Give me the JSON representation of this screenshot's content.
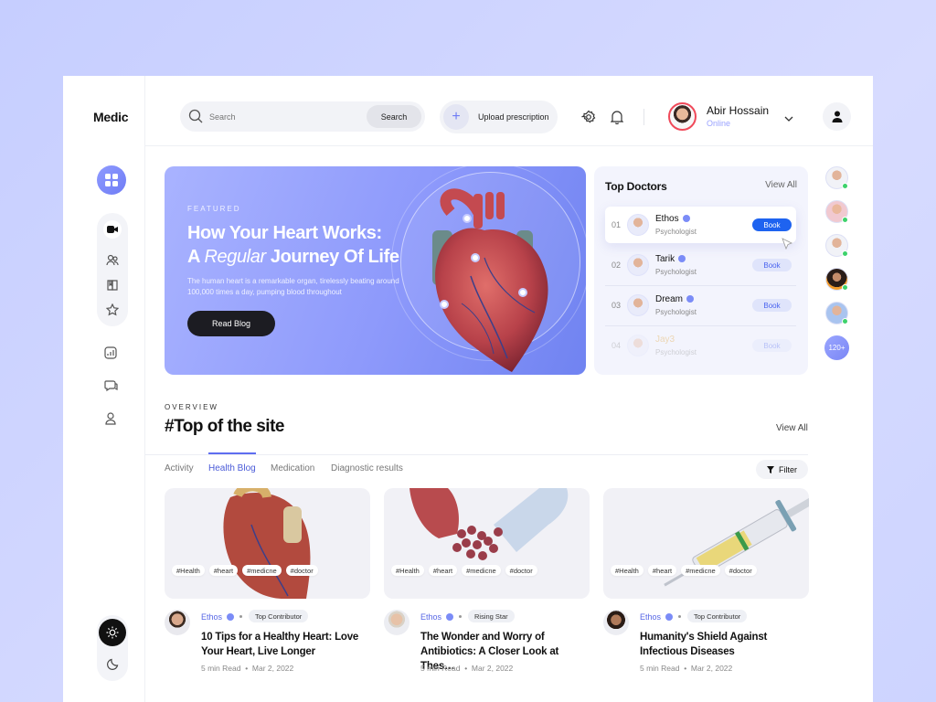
{
  "app": {
    "logo": "Medic"
  },
  "header": {
    "search_placeholder": "Search",
    "search_button": "Search",
    "upload_label": "Upload prescription",
    "user_name": "Abir Hossain",
    "user_status": "Online"
  },
  "hero": {
    "eyebrow": "FEATURED",
    "title_line1": "How Your Heart Works:",
    "title_line2_pre": "A ",
    "title_line2_em": "Regular",
    "title_line2_post": " Journey Of Life",
    "description": "The human heart is a remarkable organ, tirelessly beating around 100,000 times a day, pumping blood throughout",
    "button": "Read Blog"
  },
  "doctors": {
    "title": "Top Doctors",
    "view_all": "View All",
    "items": [
      {
        "num": "01",
        "name": "Ethos",
        "role": "Psychologist",
        "action": "Book"
      },
      {
        "num": "02",
        "name": "Tarik",
        "role": "Psychologist",
        "action": "Book"
      },
      {
        "num": "03",
        "name": "Dream",
        "role": "Psychologist",
        "action": "Book"
      },
      {
        "num": "04",
        "name": "Jay3",
        "role": "Psychologist",
        "action": "Book"
      }
    ]
  },
  "rail": {
    "more": "120+"
  },
  "overview": {
    "eyebrow": "OVERVIEW",
    "title": "#Top of the site",
    "view_all": "View All",
    "tabs": [
      "Activity",
      "Health Blog",
      "Medication",
      "Diagnostic results"
    ],
    "filter": "Filter"
  },
  "cards": [
    {
      "tags": [
        "#Health",
        "#heart",
        "#medicne",
        "#doctor"
      ],
      "author": "Ethos",
      "badge": "Top Contributor",
      "title": "10 Tips for a Healthy Heart: Love Your Heart, Live Longer",
      "read": "5 min Read",
      "date": "Mar 2, 2022"
    },
    {
      "tags": [
        "#Health",
        "#heart",
        "#medicne",
        "#doctor"
      ],
      "author": "Ethos",
      "badge": "Rising Star",
      "title": "The Wonder and Worry of Antibiotics: A Closer Look at Thes…",
      "read": "5 min Read",
      "date": "Mar 2, 2022"
    },
    {
      "tags": [
        "#Health",
        "#heart",
        "#medicne",
        "#doctor"
      ],
      "author": "Ethos",
      "badge": "Top Contributor",
      "title": "Humanity's Shield Against Infectious Diseases",
      "read": "5 min Read",
      "date": "Mar 2, 2022"
    }
  ],
  "colors": {
    "accent": "#6f7cf5",
    "book_active": "#1e63f0",
    "online": "#3dd26b"
  }
}
